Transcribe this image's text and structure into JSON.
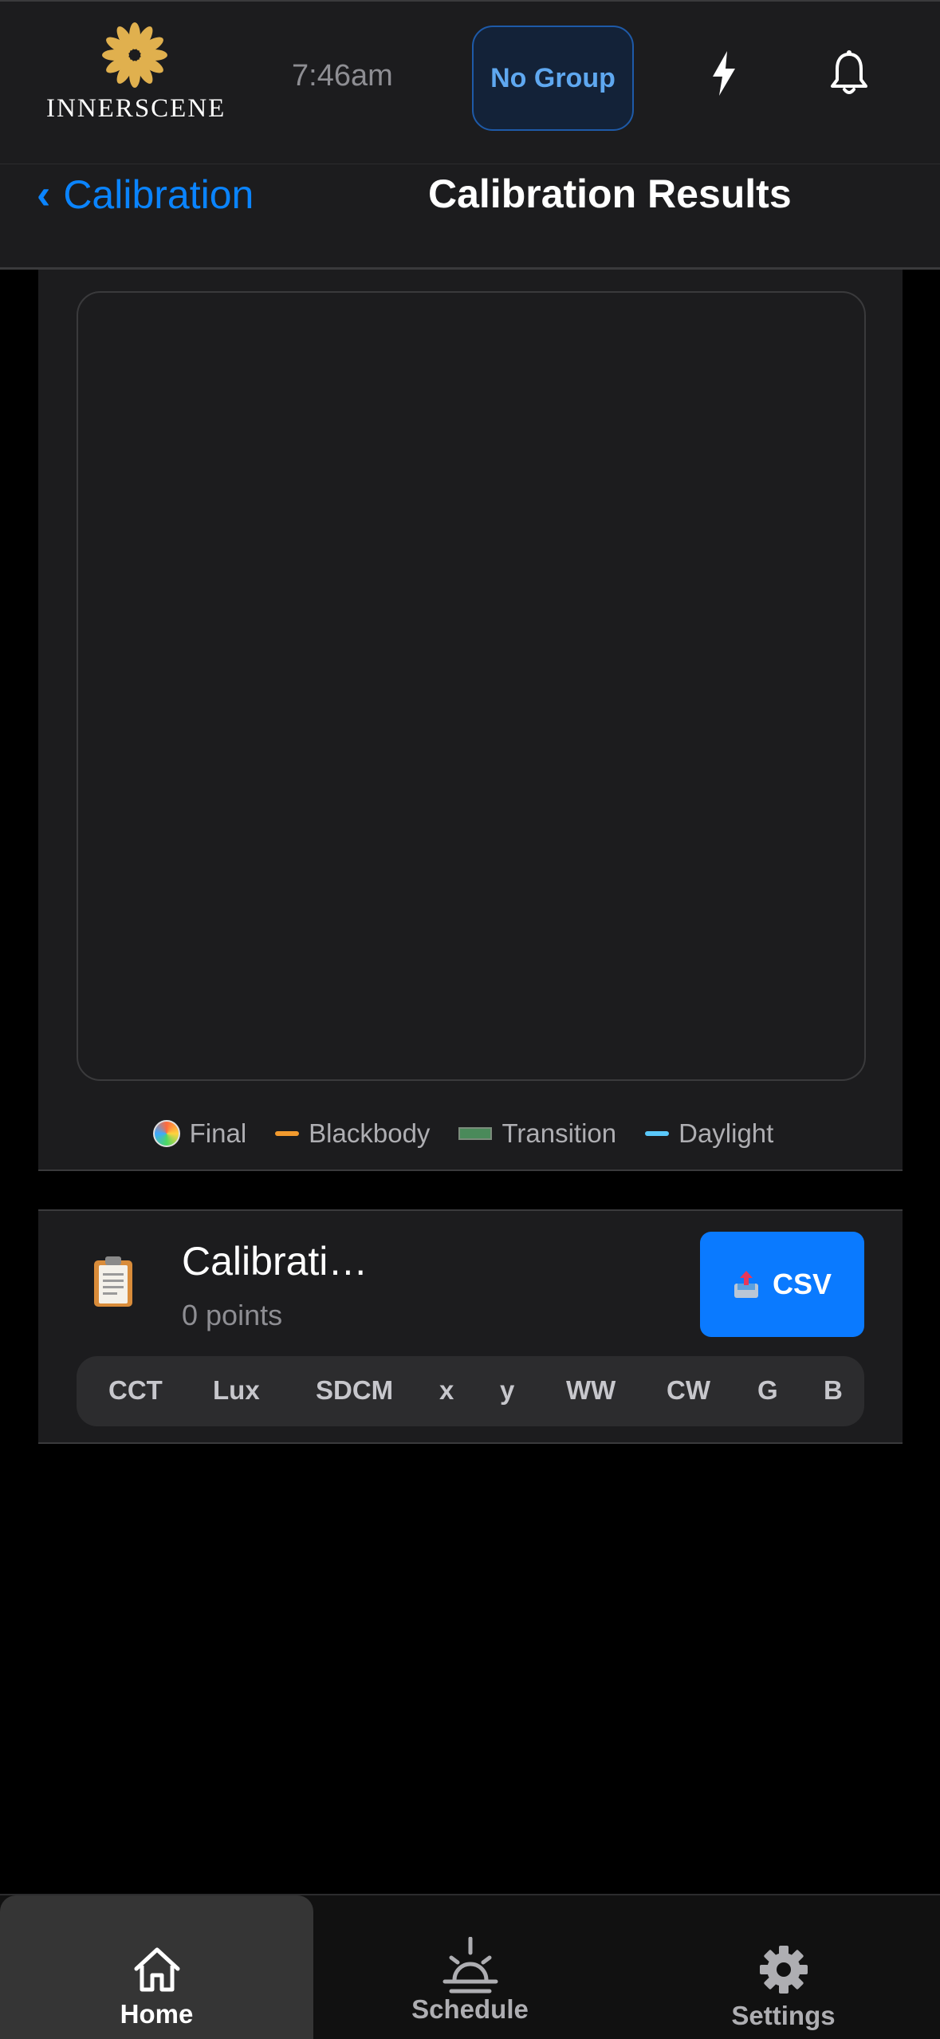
{
  "header": {
    "logo_text": "INNERSCENE",
    "time": "7:46am",
    "group_button": "No Group",
    "icons": {
      "bolt": "bolt-icon",
      "bell": "bell-icon",
      "logo": "sunburst-logo-icon"
    },
    "colors": {
      "background": "#1c1c1e",
      "accent": "#0a84ff",
      "logo_gold": "#e0b04e"
    }
  },
  "nav": {
    "back_label": "Calibration",
    "title": "Calibration Results"
  },
  "chart": {
    "legend": [
      {
        "label": "Final",
        "color": "conic"
      },
      {
        "label": "Blackbody",
        "color": "#f29a2e"
      },
      {
        "label": "Transition",
        "color": "#4a8a5a"
      },
      {
        "label": "Daylight",
        "color": "#5ac8fa"
      }
    ]
  },
  "results": {
    "title": "Calibrati…",
    "subtitle": "0 points",
    "csv_label": "CSV",
    "columns": [
      "CCT",
      "Lux",
      "SDCM",
      "x",
      "y",
      "WW",
      "CW",
      "G",
      "B"
    ]
  },
  "tabs": [
    {
      "label": "Home",
      "icon": "home-icon",
      "active": true
    },
    {
      "label": "Schedule",
      "icon": "sunrise-icon",
      "active": false
    },
    {
      "label": "Settings",
      "icon": "gear-icon",
      "active": false
    }
  ]
}
